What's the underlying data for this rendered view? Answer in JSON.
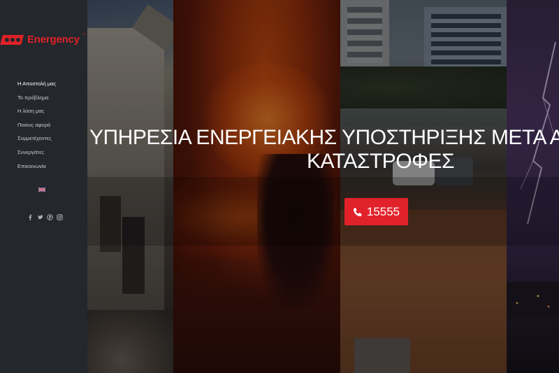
{
  "brand": {
    "name": "Energency",
    "trademark": "™",
    "color": "#e02127"
  },
  "sidebar": {
    "items": [
      {
        "label": "Η Αποστολή μας",
        "active": true
      },
      {
        "label": "Το πρόβλημα"
      },
      {
        "label": "Η λύση μας"
      },
      {
        "label": "Ποιους αφορά"
      },
      {
        "label": "Συμμετέχοντες"
      },
      {
        "label": "Συνεργάτες"
      },
      {
        "label": "Επικοινωνία"
      }
    ],
    "language_flag": "uk-flag-icon",
    "social": [
      "facebook-icon",
      "twitter-icon",
      "pinterest-icon",
      "instagram-icon"
    ]
  },
  "hero": {
    "headline_line1": "ΥΠΗΡΕΣΙΑ ΕΝΕΡΓΕΙΑΚΗΣ ΥΠΟΣΤΗΡΙΞΗΣ ΜΕΤΑ ΑΠ",
    "headline_line2": "ΚΑΤΑΣΤΡΟΦΕΣ",
    "cta": {
      "phone": "15555",
      "icon": "phone-icon",
      "color": "#e2222a"
    }
  }
}
